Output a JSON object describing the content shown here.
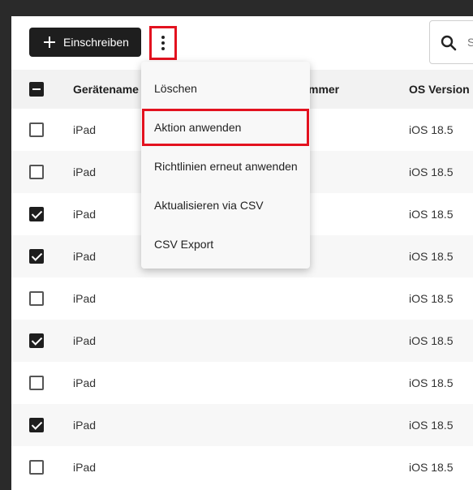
{
  "toolbar": {
    "enroll_label": "Einschreiben",
    "search_placeholder": "S"
  },
  "table": {
    "headers": {
      "device_name": "Gerätename",
      "serial_number": "mmer",
      "os_version": "OS Version"
    },
    "rows": [
      {
        "checked": false,
        "name": "iPad",
        "os": "iOS 18.5"
      },
      {
        "checked": false,
        "name": "iPad",
        "os": "iOS 18.5"
      },
      {
        "checked": true,
        "name": "iPad",
        "os": "iOS 18.5"
      },
      {
        "checked": true,
        "name": "iPad",
        "os": "iOS 18.5"
      },
      {
        "checked": false,
        "name": "iPad",
        "os": "iOS 18.5"
      },
      {
        "checked": true,
        "name": "iPad",
        "os": "iOS 18.5"
      },
      {
        "checked": false,
        "name": "iPad",
        "os": "iOS 18.5"
      },
      {
        "checked": true,
        "name": "iPad",
        "os": "iOS 18.5"
      },
      {
        "checked": false,
        "name": "iPad",
        "os": "iOS 18.5"
      }
    ]
  },
  "menu": {
    "items": [
      {
        "label": "Löschen",
        "highlighted": false
      },
      {
        "label": "Aktion anwenden",
        "highlighted": true
      },
      {
        "label": "Richtlinien erneut anwenden",
        "highlighted": false
      },
      {
        "label": "Aktualisieren via CSV",
        "highlighted": false
      },
      {
        "label": "CSV Export",
        "highlighted": false
      }
    ]
  },
  "colors": {
    "highlight": "#e3121f",
    "button_bg": "#1e1e1e"
  }
}
